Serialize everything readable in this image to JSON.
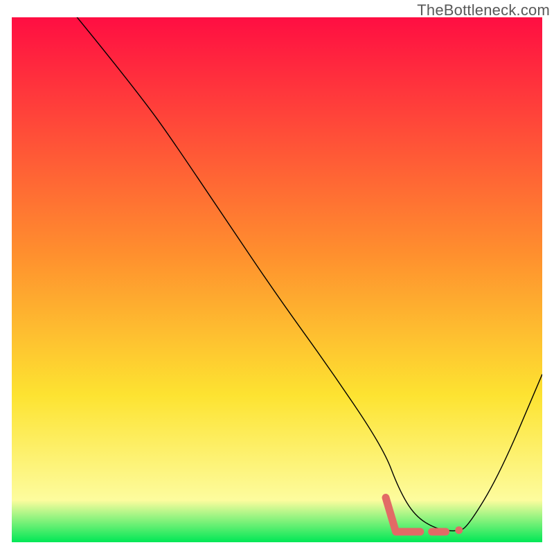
{
  "watermark": "TheBottleneck.com",
  "chart_data": {
    "type": "line",
    "title": "",
    "xlabel": "",
    "ylabel": "",
    "xlim": [
      0,
      100
    ],
    "ylim": [
      0,
      100
    ],
    "grid": false,
    "gradient_colors": {
      "top": "#ff0e42",
      "mid_upper": "#ff8f2e",
      "mid": "#fde331",
      "low": "#fdfc9e",
      "bottom": "#00e756"
    },
    "series": [
      {
        "name": "curve",
        "stroke": "#000000",
        "stroke_width": 1.4,
        "x": [
          0,
          14,
          25,
          30,
          40,
          50,
          60,
          70,
          73,
          76,
          80,
          84,
          86,
          92,
          100
        ],
        "y": [
          115,
          98,
          84,
          77,
          62,
          47,
          33,
          18,
          10,
          5,
          2.5,
          2,
          3,
          13,
          32
        ]
      },
      {
        "name": "optimal-zone",
        "type": "markers",
        "stroke": "#e26a66",
        "stroke_width": 11,
        "points": [
          {
            "kind": "L",
            "x0": 70.5,
            "y0": 8.5,
            "x1": 72.4,
            "y1": 2.0,
            "x2": 77.0,
            "y2": 2.0
          },
          {
            "kind": "dash",
            "x0": 79.2,
            "y0": 2.0,
            "x1": 81.8,
            "y1": 2.0
          },
          {
            "kind": "dot",
            "x0": 84.3,
            "y0": 2.3
          }
        ]
      }
    ]
  }
}
